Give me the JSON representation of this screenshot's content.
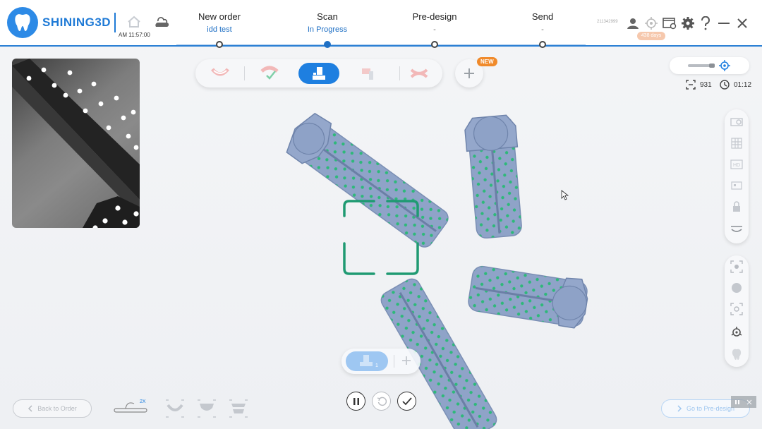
{
  "app": {
    "brand": "SHINING3D",
    "time": "AM 11:57:00",
    "account_id": "211342999",
    "trial_badge": "438 days"
  },
  "steps": [
    {
      "title": "New order",
      "sub": "idd test",
      "state": "done"
    },
    {
      "title": "Scan",
      "sub": "In Progress",
      "state": "active"
    },
    {
      "title": "Pre-design",
      "sub": "-",
      "state": "pending"
    },
    {
      "title": "Send",
      "sub": "-",
      "state": "pending"
    }
  ],
  "toolbar": {
    "items": [
      "upper-jaw-icon",
      "lower-jaw-icon",
      "scanbody-icon",
      "abutment-icon",
      "bite-icon"
    ],
    "active_index": 2,
    "new_badge": "NEW"
  },
  "status": {
    "frames": "931",
    "elapsed": "01:12"
  },
  "side_panel_top": [
    "texture-icon",
    "grid-icon",
    "hd-icon",
    "crop-icon",
    "lock-icon",
    "jaw-icon"
  ],
  "side_panel_bottom": [
    "select-icon",
    "brush-icon",
    "focus-icon",
    "align-icon",
    "tooth-icon"
  ],
  "scan_pill": {
    "seg_label": "1"
  },
  "bottom": {
    "back_label": "Back to Order",
    "forward_label": "Go to Pre-design",
    "tool_speed": "2X"
  },
  "colors": {
    "accent": "#1e7fe0",
    "scan_body": "#8fa3c8",
    "marker": "#2eb87a",
    "reticle": "#1f9a72"
  }
}
